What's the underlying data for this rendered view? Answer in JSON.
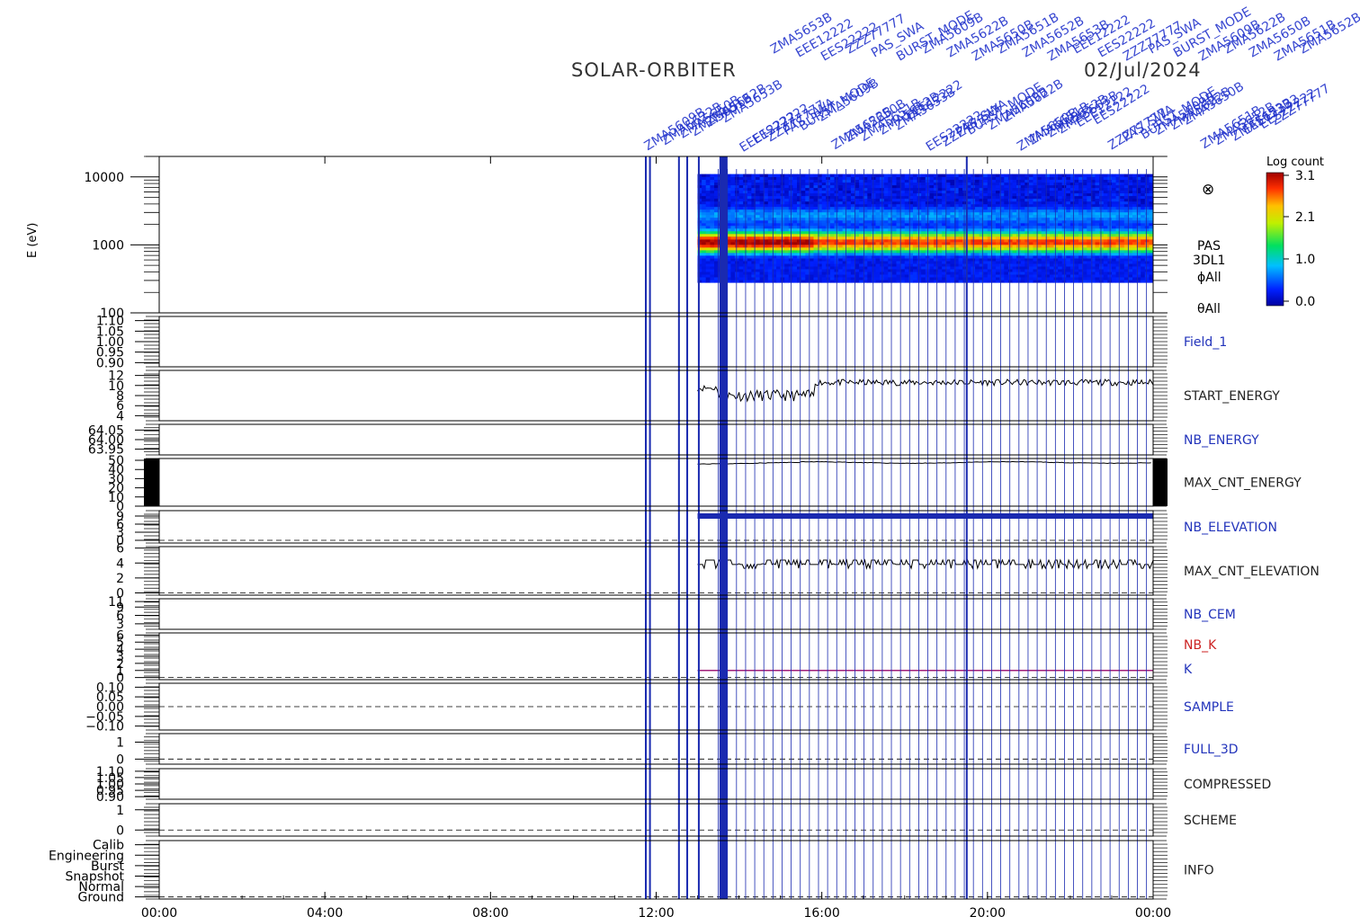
{
  "header": {
    "mission": "SOLAR-ORBITER",
    "date": "02/Jul/2024"
  },
  "colorbar": {
    "title": "Log count",
    "ticks": [
      "3.1",
      "2.1",
      "1.0",
      "0.0"
    ]
  },
  "spectrogram_labels": {
    "instrument": "PAS",
    "mode": "3DL1",
    "phi": "ϕAll",
    "theta": "θAll",
    "direction_symbol": "⊗"
  },
  "overlay_labels": [
    "ZMA5609B",
    "ZMA5622B",
    "ZMA5650B",
    "ZMA5651B",
    "ZMA5652B",
    "ZMA5653B",
    "EEE12222",
    "EES22222",
    "ZZZ77777",
    "PAS_SWA",
    "BURST_MODE"
  ],
  "chart_data": {
    "type": "multi-panel-timeseries",
    "x_axis": {
      "ticks": [
        "00:00",
        "04:00",
        "08:00",
        "12:00",
        "16:00",
        "20:00",
        "00:00"
      ],
      "range_hours": [
        0,
        24
      ]
    },
    "panels": [
      {
        "name": "energy-spectrogram",
        "type": "heatmap",
        "ylabel": "E (eV)",
        "yscale": "log",
        "ylim": [
          100,
          20000
        ],
        "ytick_labels": [
          "10000",
          "1000",
          "100"
        ],
        "ytick_values": [
          10000,
          1000,
          100
        ],
        "data_start_hour": 13.0,
        "data_end_hour": 24.0,
        "peak_energy_ev": 1100,
        "colorbar_range": [
          0.0,
          3.1
        ]
      },
      {
        "name": "Field_1",
        "label": "Field_1",
        "label_color": "#2233bb",
        "ytick_labels": [
          "1.10",
          "1.05",
          "1.00",
          "0.95",
          "0.90"
        ],
        "ytick_values": [
          1.1,
          1.05,
          1.0,
          0.95,
          0.9
        ],
        "ylim": [
          0.88,
          1.12
        ]
      },
      {
        "name": "START_ENERGY",
        "label": "START_ENERGY",
        "label_color": "#222222",
        "ytick_labels": [
          "12",
          "10",
          "8",
          "6",
          "4"
        ],
        "ytick_values": [
          12,
          10,
          8,
          6,
          4
        ],
        "ylim": [
          3,
          13
        ],
        "series": {
          "start_hour": 13.0,
          "end_hour": 24.0,
          "segments": [
            [
              13.0,
              9.5
            ],
            [
              13.6,
              8.0
            ],
            [
              15.8,
              8.0
            ],
            [
              15.8,
              11.2
            ],
            [
              24.0,
              10.5
            ]
          ]
        }
      },
      {
        "name": "NB_ENERGY",
        "label": "NB_ENERGY",
        "label_color": "#2233bb",
        "ytick_labels": [
          "64.05",
          "64.00",
          "63.95"
        ],
        "ytick_values": [
          64.05,
          64.0,
          63.95
        ],
        "ylim": [
          63.92,
          64.08
        ]
      },
      {
        "name": "MAX_CNT_ENERGY",
        "label": "MAX_CNT_ENERGY",
        "label_color": "#222222",
        "ytick_labels": [
          "50",
          "40",
          "30",
          "20",
          "10",
          "0"
        ],
        "ytick_values": [
          50,
          40,
          30,
          20,
          10,
          0
        ],
        "ylim": [
          0,
          52
        ],
        "series": {
          "start_hour": 13.0,
          "end_hour": 24.0,
          "value": 47
        }
      },
      {
        "name": "NB_ELEVATION",
        "label": "NB_ELEVATION",
        "label_color": "#2233bb",
        "ytick_labels": [
          "9",
          "6",
          "3",
          "0"
        ],
        "ytick_values": [
          9,
          6,
          3,
          0
        ],
        "ylim": [
          -1,
          11
        ],
        "series": {
          "start_hour": 13.0,
          "end_hour": 24.0,
          "value": 9
        }
      },
      {
        "name": "MAX_CNT_ELEVATION",
        "label": "MAX_CNT_ELEVATION",
        "label_color": "#222222",
        "ytick_labels": [
          "6",
          "4",
          "2",
          "0"
        ],
        "ytick_values": [
          6,
          4,
          2,
          0
        ],
        "ylim": [
          -0.3,
          6.2
        ],
        "series": {
          "start_hour": 13.0,
          "end_hour": 24.0,
          "value": 3.8
        }
      },
      {
        "name": "NB_CEM",
        "label": "NB_CEM",
        "label_color": "#2233bb",
        "ytick_labels": [
          "11",
          "9",
          "6",
          "3"
        ],
        "ytick_values": [
          11,
          9,
          6,
          3
        ],
        "ylim": [
          1,
          12
        ]
      },
      {
        "name": "NB_K",
        "label": "NB_K",
        "label_color": "#cc2222",
        "label2": "K",
        "label2_color": "#2233bb",
        "ytick_labels": [
          "6",
          "5",
          "4",
          "3",
          "2",
          "1",
          "0"
        ],
        "ytick_values": [
          6,
          5,
          4,
          3,
          2,
          1,
          0
        ],
        "ylim": [
          -0.3,
          6.3
        ],
        "series": {
          "start_hour": 13.0,
          "end_hour": 24.0,
          "value": 1
        }
      },
      {
        "name": "SAMPLE",
        "label": "SAMPLE",
        "label_color": "#2233bb",
        "ytick_labels": [
          "0.10",
          "0.05",
          "0.00",
          "−0.05",
          "−0.10"
        ],
        "ytick_values": [
          0.1,
          0.05,
          0.0,
          -0.05,
          -0.1
        ],
        "ylim": [
          -0.12,
          0.12
        ]
      },
      {
        "name": "FULL_3D",
        "label": "FULL_3D",
        "label_color": "#2233bb",
        "ytick_labels": [
          "1",
          "0"
        ],
        "ytick_values": [
          1,
          0
        ],
        "ylim": [
          -0.3,
          1.5
        ]
      },
      {
        "name": "COMPRESSED",
        "label": "COMPRESSED",
        "label_color": "#222222",
        "ytick_labels": [
          "1.10",
          "1.05",
          "1.00",
          "0.95",
          "0.90"
        ],
        "ytick_values": [
          1.1,
          1.05,
          1.0,
          0.95,
          0.9
        ],
        "ylim": [
          0.88,
          1.12
        ]
      },
      {
        "name": "SCHEME",
        "label": "SCHEME",
        "label_color": "#222222",
        "ytick_labels": [
          "1",
          "0"
        ],
        "ytick_values": [
          1,
          0
        ],
        "ylim": [
          -0.3,
          1.3
        ]
      },
      {
        "name": "INFO",
        "label": "INFO",
        "label_color": "#222222",
        "ytick_labels": [
          "Calib",
          "Engineering",
          "Burst",
          "Snapshot",
          "Normal",
          "Ground"
        ],
        "ytick_values": [
          5,
          4,
          3,
          2,
          1,
          0
        ],
        "ylim": [
          -0.2,
          5.4
        ]
      }
    ],
    "markers": {
      "color": "#1a2ab0",
      "thick_hours": [
        11.75,
        11.85,
        12.55,
        12.75,
        13.03,
        13.55,
        13.62,
        13.68,
        19.5
      ],
      "thin_start_hour": 13.5,
      "thin_end_hour": 24.0,
      "thin_step_hours": 0.22
    }
  }
}
